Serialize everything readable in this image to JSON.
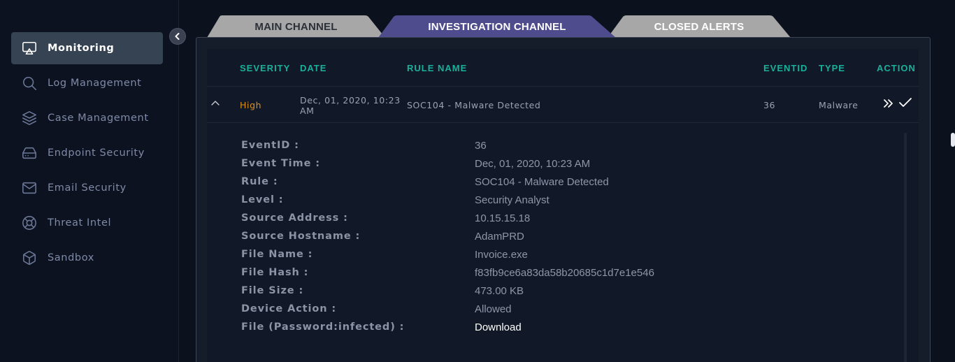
{
  "sidebar": {
    "items": [
      {
        "label": "Monitoring",
        "icon": "monitor-icon",
        "active": true
      },
      {
        "label": "Log Management",
        "icon": "search-icon",
        "active": false
      },
      {
        "label": "Case Management",
        "icon": "layers-icon",
        "active": false
      },
      {
        "label": "Endpoint Security",
        "icon": "hard-drive-icon",
        "active": false
      },
      {
        "label": "Email Security",
        "icon": "mail-icon",
        "active": false
      },
      {
        "label": "Threat Intel",
        "icon": "lifebuoy-icon",
        "active": false
      },
      {
        "label": "Sandbox",
        "icon": "box-icon",
        "active": false
      }
    ]
  },
  "tabs": [
    {
      "label": "MAIN CHANNEL",
      "color": "#a7a7a7"
    },
    {
      "label": "INVESTIGATION CHANNEL",
      "color": "#4e4c8c"
    },
    {
      "label": "CLOSED ALERTS",
      "color": "#a7a7a7"
    }
  ],
  "table": {
    "headers": {
      "severity": "SEVERITY",
      "date": "DATE",
      "rule_name": "RULE NAME",
      "eventid": "EVENTID",
      "type": "TYPE",
      "action": "ACTION"
    },
    "row": {
      "severity": "High",
      "date_line1": "Dec, 01, 2020, 10:23",
      "date_line2": "AM",
      "rule_name": "SOC104 - Malware Detected",
      "eventid": "36",
      "type": "Malware"
    }
  },
  "details": [
    {
      "label": "EventID :",
      "value": "36"
    },
    {
      "label": "Event Time :",
      "value": "Dec, 01, 2020, 10:23 AM"
    },
    {
      "label": "Rule :",
      "value": "SOC104 - Malware Detected"
    },
    {
      "label": "Level :",
      "value": "Security Analyst"
    },
    {
      "label": "Source Address :",
      "value": "10.15.15.18"
    },
    {
      "label": "Source Hostname :",
      "value": "AdamPRD"
    },
    {
      "label": "File Name :",
      "value": "Invoice.exe"
    },
    {
      "label": "File Hash :",
      "value": "f83fb9ce6a83da58b20685c1d7e1e546"
    },
    {
      "label": "File Size :",
      "value": "473.00 KB"
    },
    {
      "label": "Device Action :",
      "value": "Allowed"
    },
    {
      "label": "File (Password:infected) :",
      "value": "Download"
    }
  ],
  "colors": {
    "accent": "#1ab09b",
    "severity_high": "#e0921c",
    "active_tab": "#4e4c8c",
    "inactive_tab": "#a7a7a7"
  }
}
